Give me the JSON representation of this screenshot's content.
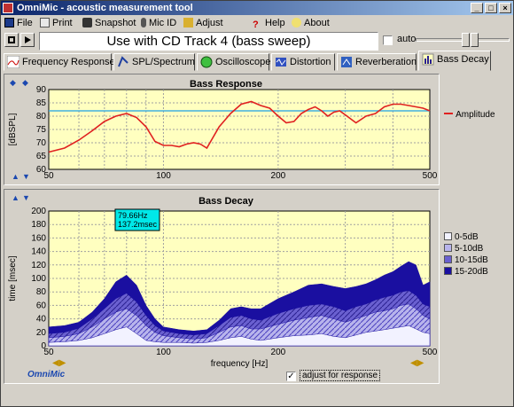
{
  "window": {
    "title": "OmniMic - acoustic measurement tool"
  },
  "menu": [
    {
      "label": "File",
      "icon": "save-icon"
    },
    {
      "label": "Print",
      "icon": "print-icon"
    },
    {
      "label": "Snapshot",
      "icon": "camera-icon"
    },
    {
      "label": "Mic ID",
      "icon": "mic-icon"
    },
    {
      "label": "Adjust",
      "icon": "adjust-icon"
    },
    {
      "label": "Help",
      "icon": "help-icon"
    },
    {
      "label": "About",
      "icon": "about-icon"
    }
  ],
  "toolbar": {
    "track_label": "Use with CD Track 4 (bass sweep)",
    "auto_label": "auto",
    "auto_checked": false
  },
  "tabs": [
    {
      "label": "Frequency Response",
      "icon": "frequency-response-icon"
    },
    {
      "label": "SPL/Spectrum",
      "icon": "spl-spectrum-icon"
    },
    {
      "label": "Oscilloscope",
      "icon": "oscilloscope-icon"
    },
    {
      "label": "Distortion",
      "icon": "distortion-icon"
    },
    {
      "label": "Reverberation",
      "icon": "reverberation-icon"
    },
    {
      "label": "Bass Decay",
      "icon": "bass-decay-icon",
      "active": true
    }
  ],
  "bass_response": {
    "title": "Bass Response",
    "ylabel": "[dBSPL]",
    "legend": "Amplitude",
    "yticks": [
      "90",
      "85",
      "80",
      "75",
      "70",
      "65",
      "60"
    ],
    "xticks": [
      "50",
      "100",
      "200",
      "500"
    ]
  },
  "bass_decay": {
    "title": "Bass Decay",
    "ylabel": "time [msec]",
    "xlabel": "frequency [Hz]",
    "yticks": [
      "200",
      "180",
      "160",
      "140",
      "120",
      "100",
      "80",
      "60",
      "40",
      "20",
      "0"
    ],
    "xticks": [
      "50",
      "100",
      "200",
      "500"
    ],
    "cursor_freq": "79.66Hz",
    "cursor_time": "137.2msec",
    "legend": [
      "0-5dB",
      "5-10dB",
      "10-15dB",
      "15-20dB"
    ]
  },
  "footer": {
    "brand": "OmniMic",
    "adjust_label": "adjust for response",
    "adjust_checked": true
  },
  "chart_data": [
    {
      "type": "line",
      "title": "Bass Response",
      "ylabel": "[dBSPL]",
      "xscale": "log",
      "xlim": [
        50,
        500
      ],
      "ylim": [
        60,
        90
      ],
      "series": [
        {
          "name": "Amplitude",
          "color": "#e02020",
          "x": [
            50,
            55,
            60,
            65,
            70,
            75,
            80,
            85,
            90,
            95,
            100,
            105,
            110,
            115,
            120,
            125,
            130,
            140,
            150,
            160,
            170,
            180,
            190,
            200,
            210,
            220,
            230,
            240,
            250,
            260,
            270,
            280,
            290,
            300,
            320,
            340,
            360,
            380,
            400,
            420,
            440,
            460,
            480,
            500
          ],
          "y": [
            66.5,
            68,
            71,
            74.5,
            78,
            80,
            81,
            79.5,
            76,
            70.5,
            69,
            69,
            68.5,
            69.5,
            70,
            69.5,
            68,
            76,
            81,
            84.5,
            85.5,
            84,
            83,
            80,
            77.5,
            78,
            81,
            82.5,
            83.5,
            82,
            80,
            81.5,
            82,
            80.5,
            77.5,
            80,
            81,
            83.5,
            84.5,
            84.5,
            84,
            83.5,
            83,
            82
          ]
        }
      ],
      "reference_line": 82
    },
    {
      "type": "area",
      "title": "Bass Decay",
      "xlabel": "frequency [Hz]",
      "ylabel": "time [msec]",
      "xscale": "log",
      "xlim": [
        50,
        500
      ],
      "ylim": [
        0,
        200
      ],
      "x": [
        50,
        55,
        60,
        65,
        70,
        75,
        80,
        85,
        90,
        95,
        100,
        110,
        120,
        130,
        140,
        150,
        160,
        170,
        180,
        200,
        220,
        240,
        260,
        280,
        300,
        320,
        340,
        360,
        380,
        400,
        420,
        440,
        460,
        480,
        500
      ],
      "series": [
        {
          "name": "0-5dB",
          "color": "#f2f2ff",
          "values": [
            5,
            6,
            8,
            12,
            18,
            24,
            28,
            18,
            8,
            6,
            5,
            5,
            4,
            5,
            8,
            12,
            14,
            10,
            8,
            12,
            15,
            16,
            18,
            14,
            12,
            16,
            20,
            22,
            24,
            26,
            28,
            30,
            25,
            20,
            18
          ]
        },
        {
          "name": "5-10dB",
          "color": "#8a82d8",
          "values": [
            12,
            14,
            18,
            28,
            40,
            50,
            55,
            45,
            30,
            20,
            15,
            12,
            10,
            12,
            20,
            28,
            30,
            25,
            25,
            32,
            38,
            42,
            45,
            40,
            35,
            40,
            45,
            50,
            52,
            55,
            60,
            62,
            55,
            45,
            40
          ]
        },
        {
          "name": "10-15dB",
          "color": "#4a3fbf",
          "values": [
            18,
            20,
            26,
            40,
            55,
            70,
            78,
            65,
            45,
            30,
            22,
            18,
            16,
            18,
            30,
            42,
            45,
            40,
            38,
            48,
            55,
            60,
            62,
            58,
            52,
            58,
            62,
            68,
            72,
            75,
            80,
            82,
            75,
            62,
            58
          ]
        },
        {
          "name": "15-20dB",
          "color": "#1a0fa0",
          "values": [
            28,
            30,
            35,
            50,
            70,
            95,
            105,
            90,
            60,
            40,
            28,
            24,
            22,
            24,
            38,
            55,
            58,
            55,
            55,
            70,
            80,
            90,
            92,
            88,
            85,
            88,
            92,
            98,
            105,
            110,
            118,
            125,
            120,
            90,
            95
          ]
        }
      ],
      "cursor": {
        "freq": 79.66,
        "time": 137.2
      }
    }
  ]
}
